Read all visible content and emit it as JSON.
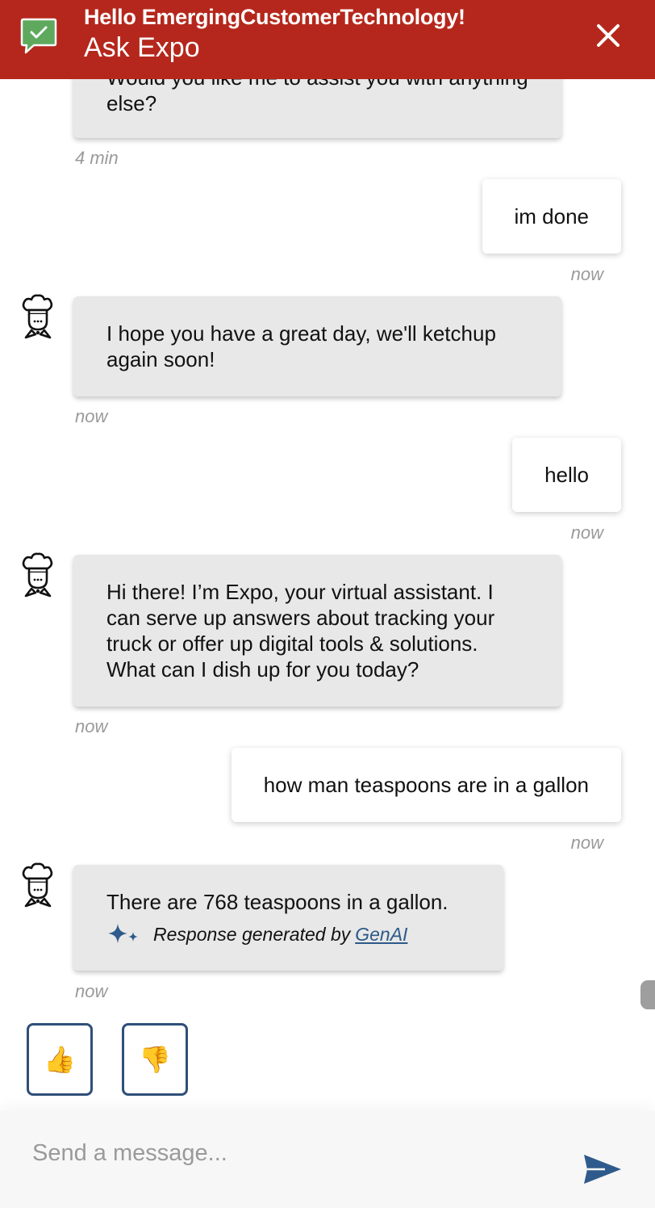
{
  "header": {
    "greeting": "Hello EmergingCustomerTechnology!",
    "title": "Ask Expo",
    "background_color": "#b5271c",
    "logo_icon": "chat-check-icon",
    "close_icon": "close-icon"
  },
  "messages": [
    {
      "sender": "bot",
      "text": "Would you like me to assist you with anything else?",
      "time": "4 min"
    },
    {
      "sender": "user",
      "text": "im done",
      "time": "now"
    },
    {
      "sender": "bot",
      "text": "I hope you have a great day, we'll ketchup again soon!",
      "time": "now"
    },
    {
      "sender": "user",
      "text": "hello",
      "time": "now"
    },
    {
      "sender": "bot",
      "text": "Hi there! I’m Expo, your virtual assistant. I can serve up answers about tracking your truck or offer up digital tools & solutions. What can I dish up for you today?",
      "time": "now"
    },
    {
      "sender": "user",
      "text": "how man teaspoons are in a gallon",
      "time": "now"
    },
    {
      "sender": "bot",
      "text": "There are 768 teaspoons in a gallon.",
      "time": "now",
      "genai_prefix": "Response generated by",
      "genai_link": "GenAI"
    }
  ],
  "feedback": {
    "thumbs_up": "👍",
    "thumbs_down": "👎",
    "border_color": "#2f4f79"
  },
  "composer": {
    "placeholder": "Send a message...",
    "send_icon": "send-icon",
    "send_color": "#2f5a8c"
  }
}
